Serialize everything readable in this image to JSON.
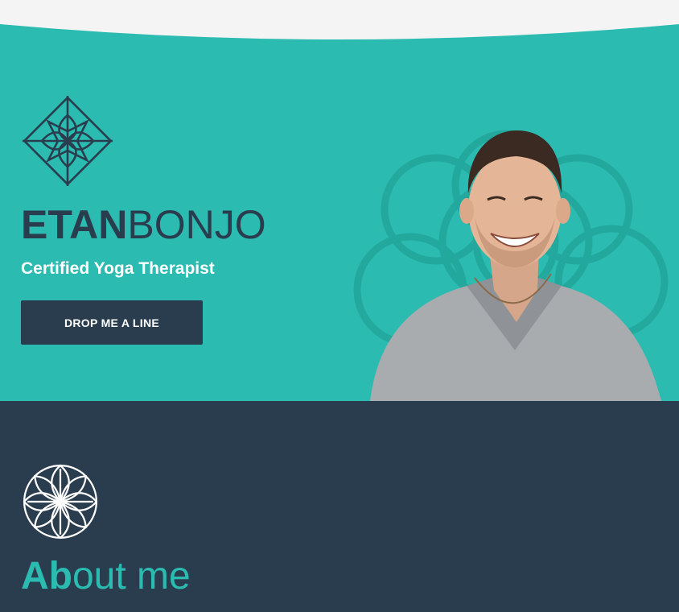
{
  "colors": {
    "teal": "#2bbbb0",
    "navy": "#2a3d4e",
    "white": "#ffffff",
    "offwhite": "#f4f4f4"
  },
  "hero": {
    "logo_icon": "lotus-diamond-icon",
    "brand_first": "ETAN",
    "brand_last": "BONJO",
    "tagline": "Certified Yoga Therapist",
    "cta_label": "DROP ME A LINE",
    "portrait_icon": "smiling-man-portrait"
  },
  "about": {
    "icon": "flower-mandala-icon",
    "title_accent": "Ab",
    "title_rest": "out me"
  }
}
